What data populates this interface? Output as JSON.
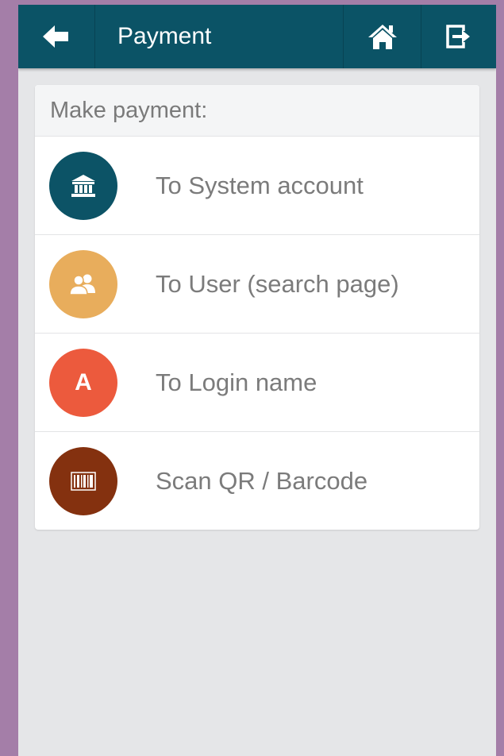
{
  "header": {
    "title": "Payment",
    "back_icon": "arrow-left-icon",
    "home_icon": "home-icon",
    "logout_icon": "logout-icon",
    "background": "#0b5366"
  },
  "card": {
    "heading": "Make payment:",
    "items": [
      {
        "label": "To System account",
        "icon": "bank-icon",
        "color": "#0c5366"
      },
      {
        "label": "To User (search page)",
        "icon": "users-icon",
        "color": "#e8ad5c"
      },
      {
        "label": "To Login name",
        "icon": "letter-a-icon",
        "icon_text": "A",
        "color": "#ec5a3d"
      },
      {
        "label": "Scan QR / Barcode",
        "icon": "barcode-icon",
        "color": "#84310f"
      }
    ]
  },
  "colors": {
    "frame": "#a47ea8",
    "screen": "#e5e6e8"
  }
}
